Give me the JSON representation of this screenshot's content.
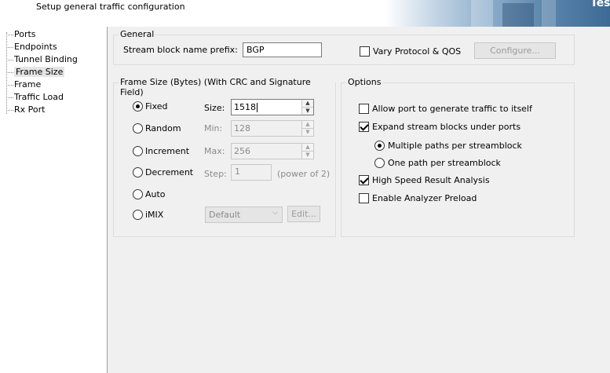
{
  "header": {
    "title": "Setup general traffic configuration",
    "brand": "Tes"
  },
  "nav": {
    "items": [
      {
        "label": "Ports"
      },
      {
        "label": "Endpoints"
      },
      {
        "label": "Tunnel Binding"
      },
      {
        "label": "Frame Size"
      },
      {
        "label": "Frame"
      },
      {
        "label": "Traffic Load"
      },
      {
        "label": "Rx Port"
      }
    ],
    "selected": "Frame Size"
  },
  "general": {
    "title": "General",
    "prefix_label": "Stream block name prefix:",
    "prefix_value": "BGP",
    "vary_label": "Vary Protocol & QOS",
    "vary_checked": false,
    "configure_label": "Configure..."
  },
  "frame_size": {
    "title": "Frame Size (Bytes) (With CRC and Signature Field)",
    "radios": {
      "fixed": "Fixed",
      "random": "Random",
      "increment": "Increment",
      "decrement": "Decrement",
      "auto": "Auto",
      "imix": "iMIX"
    },
    "selected": "Fixed",
    "size_label": "Size:",
    "size_value": "1518",
    "min_label": "Min:",
    "min_value": "128",
    "max_label": "Max:",
    "max_value": "256",
    "step_label": "Step:",
    "step_value": "1",
    "step_hint": "(power of 2)",
    "imix_value": "Default",
    "edit_label": "Edit..."
  },
  "options": {
    "title": "Options",
    "allow_self": {
      "label": "Allow port to generate traffic to itself",
      "checked": false
    },
    "expand": {
      "label": "Expand stream blocks under ports",
      "checked": true
    },
    "multiple_paths": {
      "label": "Multiple paths per streamblock",
      "selected": true
    },
    "one_path": {
      "label": "One path per streamblock",
      "selected": false
    },
    "high_speed": {
      "label": "High Speed Result Analysis",
      "checked": true
    },
    "preload": {
      "label": "Enable Analyzer Preload",
      "checked": false
    }
  }
}
